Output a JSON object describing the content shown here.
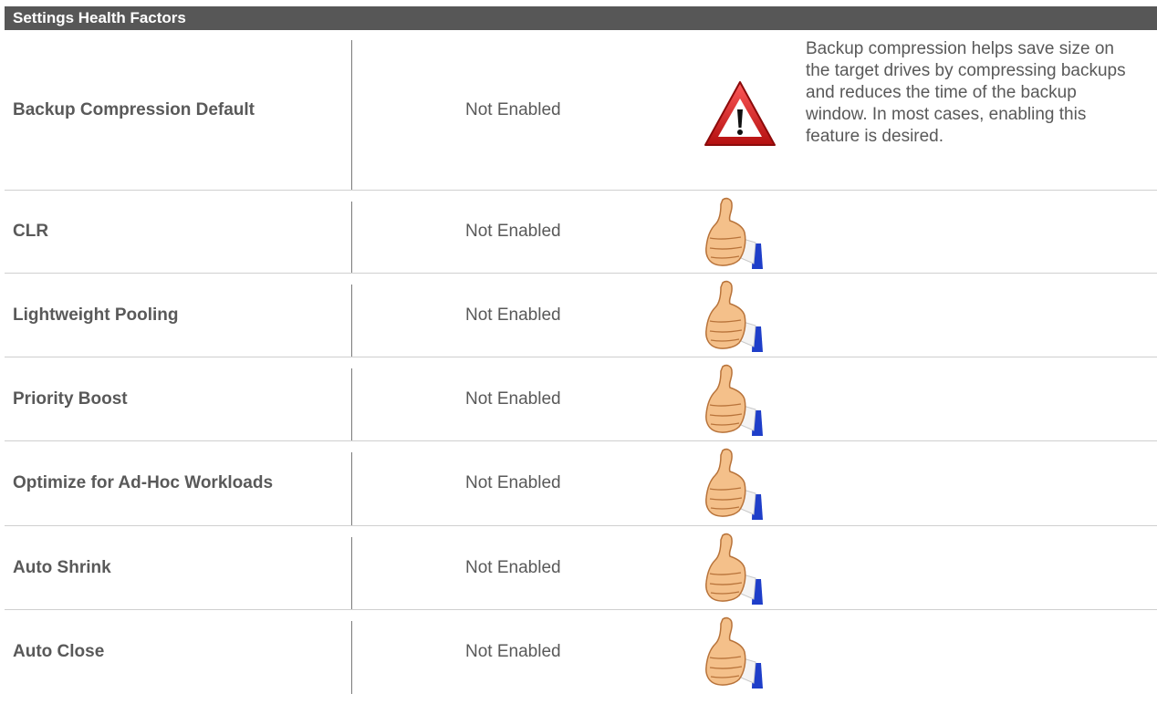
{
  "header": {
    "title": "Settings Health Factors"
  },
  "rows": [
    {
      "name": "Backup Compression Default",
      "value": "Not Enabled",
      "status_icon": "warning-icon",
      "description": "Backup compression helps save size on the target drives by compressing backups and reduces the time of the backup window. In most cases, enabling this feature is desired."
    },
    {
      "name": "CLR",
      "value": "Not Enabled",
      "status_icon": "thumbs-up-icon",
      "description": ""
    },
    {
      "name": "Lightweight Pooling",
      "value": "Not Enabled",
      "status_icon": "thumbs-up-icon",
      "description": ""
    },
    {
      "name": "Priority Boost",
      "value": "Not Enabled",
      "status_icon": "thumbs-up-icon",
      "description": ""
    },
    {
      "name": "Optimize for Ad-Hoc Workloads",
      "value": "Not Enabled",
      "status_icon": "thumbs-up-icon",
      "description": ""
    },
    {
      "name": "Auto Shrink",
      "value": "Not Enabled",
      "status_icon": "thumbs-up-icon",
      "description": ""
    },
    {
      "name": "Auto Close",
      "value": "Not Enabled",
      "status_icon": "thumbs-up-icon",
      "description": ""
    }
  ],
  "colors": {
    "header_bg": "#575757",
    "header_text": "#ffffff",
    "body_text": "#595959",
    "warning_red": "#d81e1e"
  }
}
